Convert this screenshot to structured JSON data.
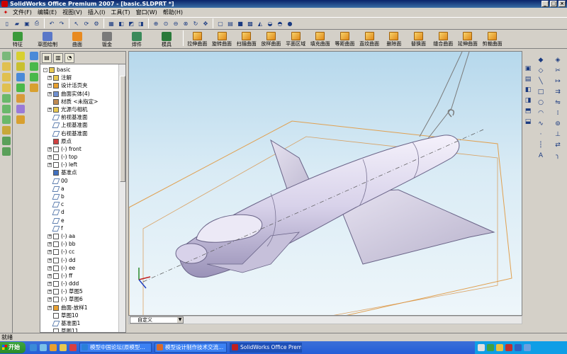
{
  "window": {
    "title": "SolidWorks Office Premium 2007 - [basic.SLDPRT *]"
  },
  "menu": [
    "文件(F)",
    "编辑(E)",
    "视图(V)",
    "插入(I)",
    "工具(T)",
    "窗口(W)",
    "帮助(H)"
  ],
  "command_manager": {
    "groups": [
      {
        "label": "特征",
        "color": "#3a9a3a"
      },
      {
        "label": "草图绘制",
        "color": "#5a78c8"
      },
      {
        "label": "曲面",
        "color": "#e88a20"
      },
      {
        "label": "钣金",
        "color": "#7a7a7a"
      },
      {
        "label": "焊件",
        "color": "#3a8a5a"
      },
      {
        "label": "模具",
        "color": "#2a7a3a"
      }
    ],
    "surface_tools": [
      "拉伸曲面",
      "旋转曲面",
      "扫描曲面",
      "放样曲面",
      "平面区域",
      "填充曲面",
      "等距曲面",
      "直纹曲面",
      "删除面",
      "替换面",
      "缝合曲面",
      "延伸曲面",
      "剪裁曲面"
    ]
  },
  "feature_tree": {
    "items": [
      {
        "label": "basic",
        "indent": 0,
        "expand": "-",
        "icon": "part"
      },
      {
        "label": "注解",
        "indent": 1,
        "expand": "+",
        "icon": "annotation"
      },
      {
        "label": "设计活页夹",
        "indent": 1,
        "expand": "+",
        "icon": "binder"
      },
      {
        "label": "曲面实体(4)",
        "indent": 1,
        "expand": "+",
        "icon": "surface-body"
      },
      {
        "label": "材质 <未指定>",
        "indent": 1,
        "expand": "",
        "icon": "material"
      },
      {
        "label": "光源与相机",
        "indent": 1,
        "expand": "+",
        "icon": "lights"
      },
      {
        "label": "前视基准面",
        "indent": 1,
        "expand": "",
        "icon": "plane"
      },
      {
        "label": "上视基准面",
        "indent": 1,
        "expand": "",
        "icon": "plane"
      },
      {
        "label": "右视基准面",
        "indent": 1,
        "expand": "",
        "icon": "plane"
      },
      {
        "label": "原点",
        "indent": 1,
        "expand": "",
        "icon": "origin"
      },
      {
        "label": "(-) front",
        "indent": 1,
        "expand": "+",
        "icon": "sketch"
      },
      {
        "label": "(-) top",
        "indent": 1,
        "expand": "+",
        "icon": "sketch"
      },
      {
        "label": "(-) left",
        "indent": 1,
        "expand": "+",
        "icon": "sketch"
      },
      {
        "label": "基准点",
        "indent": 1,
        "expand": "",
        "icon": "point"
      },
      {
        "label": "00",
        "indent": 1,
        "expand": "",
        "icon": "plane"
      },
      {
        "label": "a",
        "indent": 1,
        "expand": "",
        "icon": "plane"
      },
      {
        "label": "b",
        "indent": 1,
        "expand": "",
        "icon": "plane"
      },
      {
        "label": "c",
        "indent": 1,
        "expand": "",
        "icon": "plane"
      },
      {
        "label": "d",
        "indent": 1,
        "expand": "",
        "icon": "plane"
      },
      {
        "label": "e",
        "indent": 1,
        "expand": "",
        "icon": "plane"
      },
      {
        "label": "f",
        "indent": 1,
        "expand": "",
        "icon": "plane"
      },
      {
        "label": "(-) aa",
        "indent": 1,
        "expand": "+",
        "icon": "sketch"
      },
      {
        "label": "(-) bb",
        "indent": 1,
        "expand": "+",
        "icon": "sketch"
      },
      {
        "label": "(-) cc",
        "indent": 1,
        "expand": "+",
        "icon": "sketch"
      },
      {
        "label": "(-) dd",
        "indent": 1,
        "expand": "+",
        "icon": "sketch"
      },
      {
        "label": "(-) ee",
        "indent": 1,
        "expand": "+",
        "icon": "sketch"
      },
      {
        "label": "(-) ff",
        "indent": 1,
        "expand": "+",
        "icon": "sketch"
      },
      {
        "label": "(-) ddd",
        "indent": 1,
        "expand": "+",
        "icon": "sketch"
      },
      {
        "label": "(-) 草图5",
        "indent": 1,
        "expand": "+",
        "icon": "sketch"
      },
      {
        "label": "(-) 草图6",
        "indent": 1,
        "expand": "+",
        "icon": "sketch"
      },
      {
        "label": "曲面-放样1",
        "indent": 1,
        "expand": "+",
        "icon": "loft"
      },
      {
        "label": "草图10",
        "indent": 1,
        "expand": "",
        "icon": "sketch"
      },
      {
        "label": "基准面1",
        "indent": 1,
        "expand": "",
        "icon": "plane"
      },
      {
        "label": "草图11",
        "indent": 1,
        "expand": "",
        "icon": "sketch"
      }
    ]
  },
  "viewport": {
    "view_combo": "自定义"
  },
  "status": {
    "text": "就绪"
  },
  "taskbar": {
    "start": "开始",
    "tasks": [
      {
        "label": "模型中国论坛(原模型...",
        "color": "#2a7fd8",
        "active": false
      },
      {
        "label": "模型设计制作技术交流...",
        "color": "#d86a2a",
        "active": false
      },
      {
        "label": "SolidWorks Office Premiu...",
        "color": "#c02020",
        "active": true
      }
    ]
  }
}
